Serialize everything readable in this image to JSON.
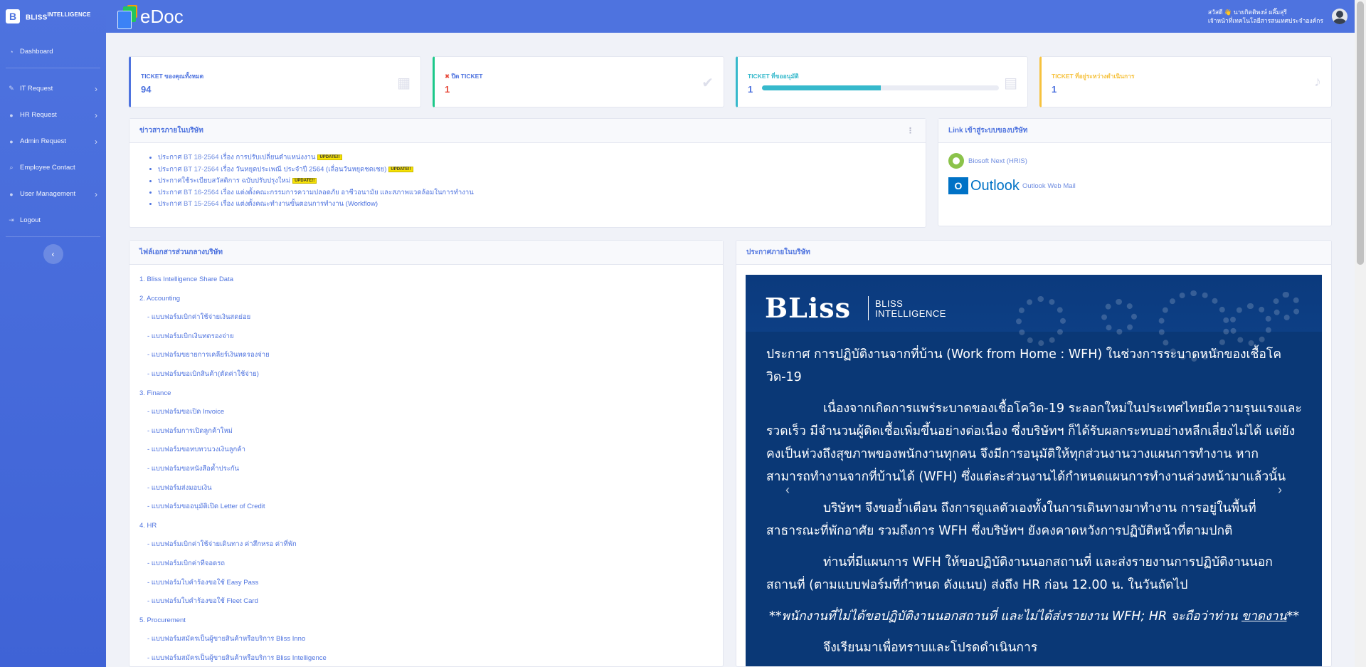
{
  "sidebar": {
    "brand": "BLISS",
    "brand_sup": "INTELLIGENCE",
    "items": [
      {
        "label": "Dashboard",
        "icon": "dashboard-icon"
      },
      {
        "label": "IT Request",
        "icon": "wrench-icon"
      },
      {
        "label": "HR Request",
        "icon": "user-icon"
      },
      {
        "label": "Admin Request",
        "icon": "users-icon"
      },
      {
        "label": "Employee Contact",
        "icon": "search-icon"
      },
      {
        "label": "User Management",
        "icon": "user-gear-icon"
      },
      {
        "label": "Logout",
        "icon": "logout-icon"
      }
    ],
    "toggle": "‹"
  },
  "topbar": {
    "app_title": "eDoc",
    "user_name": "สวัสดี 👋 นายกิตติพงษ์ ผลึ๊มสุรี",
    "user_role": "เจ้าหน้าที่เทคโนโลยีสารสนเทศประจำองค์กร"
  },
  "stats": {
    "all_tickets": {
      "title": "TICKET ของคุณทั้งหมด",
      "value": "94"
    },
    "closed_tickets": {
      "title": "ปิด TICKET",
      "value": "1"
    },
    "pending_approval": {
      "title": "TICKET ที่ขออนุมัติ",
      "value": "1",
      "progress_percent": 50
    },
    "in_progress": {
      "title": "TICKET ที่อยู่ระหว่างดำเนินการ",
      "value": "1"
    }
  },
  "news": {
    "title": "ข่าวสารภายในบริษัท",
    "menu": "⋮",
    "badge": "UPDATE!!",
    "items": [
      {
        "prefix": "ประกาศ ",
        "code": "BT 18-2564",
        "text": " เรื่อง การปรับเปลี่ยนตำแหน่งงาน",
        "badge": true
      },
      {
        "prefix": "ประกาศ ",
        "code": "BT 17-2564",
        "text": " เรื่อง วันหยุดประเพณี ประจำปี 2564 (เลื่อนวันหยุดชดเชย)",
        "badge": true
      },
      {
        "prefix": "ประกาศใช้ระเบียบสวัสดิการ ฉบับปรับปรุงใหม่",
        "code": "",
        "text": "",
        "badge": true
      },
      {
        "prefix": "ประกาศ ",
        "code": "BT 16-2564",
        "text": " เรื่อง แต่งตั้งคณะกรรมการความปลอดภัย อาชีวอนามัย และสภาพแวดล้อมในการทำงาน",
        "badge": false
      },
      {
        "prefix": "ประกาศ ",
        "code": "BT 15-2564",
        "text": " เรื่อง แต่งตั้งคณะทำงานขั้นตอนการทำงาน (Workflow)",
        "badge": false
      }
    ]
  },
  "links": {
    "title": "Link เข้าสู่ระบบของบริษัท",
    "biosoft": "Biosoft Next (HRIS)",
    "outlook_word": "Outlook",
    "outlook_label": "Outlook Web Mail"
  },
  "files": {
    "title": "ไฟล์เอกสารส่วนกลางบริษัท",
    "items": [
      {
        "text": "1. Bliss Intelligence Share Data",
        "sub": false
      },
      {
        "text": "2. Accounting",
        "sub": false
      },
      {
        "text": "- แบบฟอร์มเบิกค่าใช้จ่ายเงินสดย่อย",
        "sub": true
      },
      {
        "text": "- แบบฟอร์มเบิกเงินทดรองจ่าย",
        "sub": true
      },
      {
        "text": "- แบบฟอร์มขยายการเคลียร์เงินทดรองจ่าย",
        "sub": true
      },
      {
        "text": "- แบบฟอร์มขอเบิกสินค้า(ตัดค่าใช้จ่าย)",
        "sub": true
      },
      {
        "text": "3. Finance",
        "sub": false
      },
      {
        "text": "- แบบฟอร์มขอเปิด Invoice",
        "sub": true
      },
      {
        "text": "- แบบฟอร์มการเปิดลูกค้าใหม่",
        "sub": true
      },
      {
        "text": "- แบบฟอร์มขอทบทวนวงเงินลูกค้า",
        "sub": true
      },
      {
        "text": "- แบบฟอร์มขอหนังสือค้ำประกัน",
        "sub": true
      },
      {
        "text": "- แบบฟอร์มส่งมอบเงิน",
        "sub": true
      },
      {
        "text": "- แบบฟอร์มขออนุมัติเปิด Letter of Credit",
        "sub": true
      },
      {
        "text": "4. HR",
        "sub": false
      },
      {
        "text": "- แบบฟอร์มเบิกค่าใช้จ่ายเดินทาง ค่าสึกหรอ ค่าที่พัก",
        "sub": true
      },
      {
        "text": "- แบบฟอร์มเบิกค่าทีจอดรถ",
        "sub": true
      },
      {
        "text": "- แบบฟอร์มใบคำร้องขอใช้ Easy Pass",
        "sub": true
      },
      {
        "text": "- แบบฟอร์มใบคำร้องขอใช้ Fleet Card",
        "sub": true
      },
      {
        "text": "5. Procurement",
        "sub": false
      },
      {
        "text": "- แบบฟอร์มสมัครเป็นผู้ขายสินค้าหรือบริการ Bliss Inno",
        "sub": true
      },
      {
        "text": "- แบบฟอร์มสมัครเป็นผู้ขายสินค้าหรือบริการ Bliss Intelligence",
        "sub": true
      }
    ]
  },
  "announcement": {
    "title": "ประกาศภายในบริษัท",
    "logo": "BLiss",
    "logo_sub1": "BLISS",
    "logo_sub2": "INTELLIGENCE",
    "heading": "ประกาศ    การปฏิบัติงานจากที่บ้าน (Work from Home : WFH) ในช่วงการระบาดหนักของเชื้อโควิด-19",
    "para1": "เนื่องจากเกิดการแพร่ระบาดของเชื้อโควิด-19 ระลอกใหม่ในประเทศไทยมีความรุนแรงและรวดเร็ว มีจำนวนผู้ติดเชื้อเพิ่มขึ้นอย่างต่อเนื่อง ซึ่งบริษัทฯ ก็ได้รับผลกระทบอย่างหลีกเลี่ยงไม่ได้ แต่ยังคงเป็นห่วงถึงสุขภาพของพนักงานทุกคน จึงมีการอนุมัติให้ทุกส่วนงานวางแผนการทำงาน หากสามารถทำงานจากที่บ้านได้ (WFH) ซึ่งแต่ละส่วนงานได้กำหนดแผนการทำงานล่วงหน้ามาแล้วนั้น",
    "para2": "บริษัทฯ จึงขอย้ำเตือน ถึงการดูแลตัวเองทั้งในการเดินทางมาทำงาน การอยู่ในพื้นที่สาธารณะที่พักอาศัย รวมถึงการ WFH ซึ่งบริษัทฯ ยังคงคาดหวังการปฏิบัติหน้าที่ตามปกติ",
    "para3": "ท่านที่มีแผนการ WFH ให้ขอปฏิบัติงานนอกสถานที่ และส่งรายงานการปฏิบัติงานนอกสถานที่ (ตามแบบฟอร์มที่กำหนด ดังแนบ) ส่งถึง HR ก่อน 12.00 น. ในวันถัดไป",
    "note_pre": "**พนักงานที่ไม่ได้ขอปฏิบัติงานนอกสถานที่ และไม่ได้ส่งรายงาน WFH; HR จะถือว่าท่าน ",
    "note_u": "ขาดงาน",
    "note_post": "**",
    "closing": "จึงเรียนมาเพื่อทราบและโปรดดำเนินการ",
    "prev": "‹",
    "next": "›"
  },
  "colors": {
    "primary": "#4e73df",
    "success": "#1cc88a",
    "info": "#36b9cc",
    "warning": "#f6c23e",
    "danger": "#e74a3b",
    "banner_bg": "#0a3876"
  }
}
